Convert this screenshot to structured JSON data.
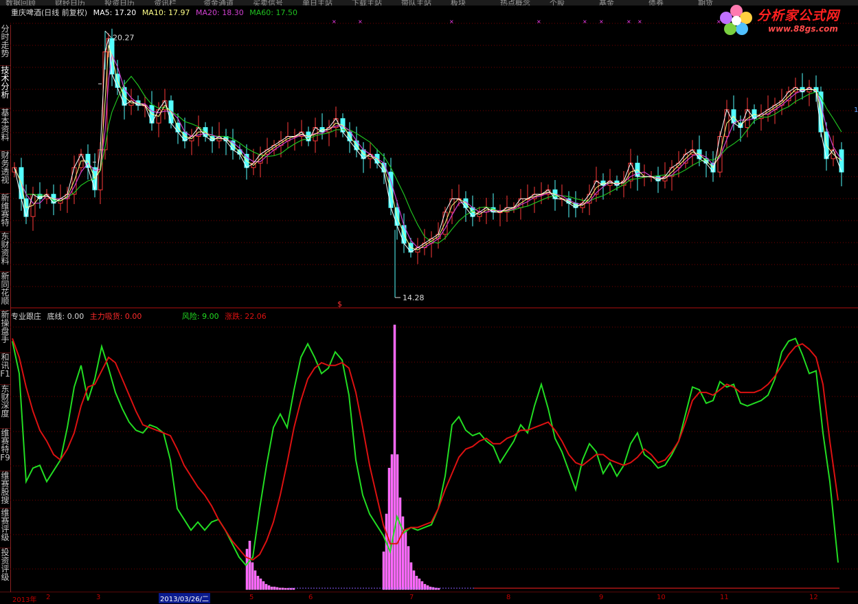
{
  "top_menu": [
    "数据回顾",
    "财经日历",
    "投资日历",
    "资讯栏",
    "资金通道",
    "买卖信号",
    "单日主站",
    "下载主站",
    "带队主站",
    "板块",
    "热点概念",
    "个股",
    "基金",
    "债券",
    "期货"
  ],
  "sidebar": [
    {
      "label": "分时走势",
      "selected": false
    },
    {
      "label": "技术分析",
      "selected": true
    },
    {
      "label": "基本资料",
      "selected": false
    },
    {
      "label": "财务透视",
      "selected": false
    },
    {
      "label": "新维赛特",
      "selected": false
    },
    {
      "label": "东财资料",
      "selected": false
    },
    {
      "label": "新同花顺",
      "selected": false
    },
    {
      "label": "新操盘手",
      "selected": false
    },
    {
      "label": "和讯F1",
      "selected": false
    },
    {
      "label": "东财深度",
      "selected": false
    },
    {
      "label": "维赛特F9",
      "selected": false
    },
    {
      "label": "维赛股搜",
      "selected": false
    },
    {
      "label": "维赛评级",
      "selected": false
    },
    {
      "label": "投资评级",
      "selected": false
    }
  ],
  "main_header": {
    "stock": "重庆啤酒(日线 前复权)",
    "ma5": "MA5: 17.20",
    "ma10": "MA10: 17.97",
    "ma20": "MA20: 18.30",
    "ma60": "MA60: 17.50"
  },
  "indicator_header": {
    "name": "专业跟庄",
    "bottom": "底线: 0.00",
    "absorb": "主力吸货: 0.00",
    "risk": "风险: 9.00",
    "change": "涨跌: 22.06"
  },
  "annotations": {
    "high": "20.27",
    "low": "14.28",
    "signal": "$"
  },
  "logo": {
    "name": "分析家公式网",
    "url": "www.88gs.com"
  },
  "right_marker": "1",
  "xaxis": {
    "labels": [
      {
        "text": "2013年"
      },
      {
        "text": "2"
      },
      {
        "text": "3"
      },
      {
        "text": "5"
      },
      {
        "text": "6"
      },
      {
        "text": "7"
      },
      {
        "text": "8"
      },
      {
        "text": "9"
      },
      {
        "text": "10"
      },
      {
        "text": "11"
      },
      {
        "text": "12"
      }
    ],
    "cursor": "2013/03/26/二"
  },
  "colors": {
    "up": "#ff3a3a",
    "down": "#54ffff",
    "ma5": "#ffffff",
    "ma10": "#ffff88",
    "ma20": "#d040d0",
    "ma60": "#20c020",
    "risk": "#22dd22",
    "change": "#dd1111",
    "absorb": "#ff60ff",
    "grid": "#7a0000"
  }
}
